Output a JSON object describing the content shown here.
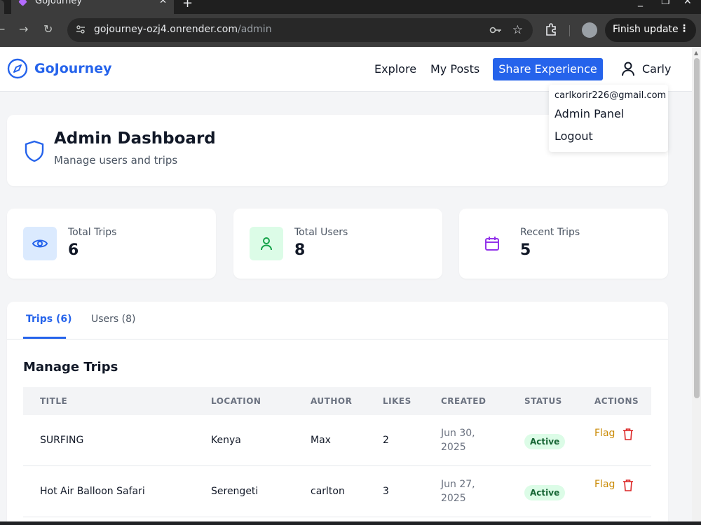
{
  "browser": {
    "tab_title": "GoJourney",
    "url_host": "gojourney-ozj4.onrender.com",
    "url_path": "/admin",
    "finish_update_label": "Finish update"
  },
  "header": {
    "brand": "GoJourney",
    "nav": {
      "explore": "Explore",
      "my_posts": "My Posts"
    },
    "share_button": "Share Experience",
    "user_name": "Carly"
  },
  "user_menu": {
    "email": "carlkorir226@gmail.com",
    "admin_panel": "Admin Panel",
    "logout": "Logout"
  },
  "admin": {
    "title": "Admin Dashboard",
    "subtitle": "Manage users and trips"
  },
  "stats": [
    {
      "label": "Total Trips",
      "value": "6"
    },
    {
      "label": "Total Users",
      "value": "8"
    },
    {
      "label": "Recent Trips",
      "value": "5"
    }
  ],
  "tabs": {
    "trips": "Trips (6)",
    "users": "Users (8)"
  },
  "manage": {
    "title": "Manage Trips",
    "columns": [
      "TITLE",
      "LOCATION",
      "AUTHOR",
      "LIKES",
      "CREATED",
      "STATUS",
      "ACTIONS"
    ],
    "rows": [
      {
        "title": "SURFING",
        "location": "Kenya",
        "author": "Max",
        "likes": "2",
        "created_line1": "Jun 30,",
        "created_line2": "2025",
        "status": "Active",
        "flag": "Flag"
      },
      {
        "title": "Hot Air Balloon Safari",
        "location": "Serengeti",
        "author": "carlton",
        "likes": "3",
        "created_line1": "Jun 27,",
        "created_line2": "2025",
        "status": "Active",
        "flag": "Flag"
      }
    ]
  },
  "colors": {
    "brand_blue": "#2563eb",
    "active_badge_bg": "#dcfce7",
    "flag_text": "#ca8a04",
    "delete_red": "#dc2626"
  }
}
